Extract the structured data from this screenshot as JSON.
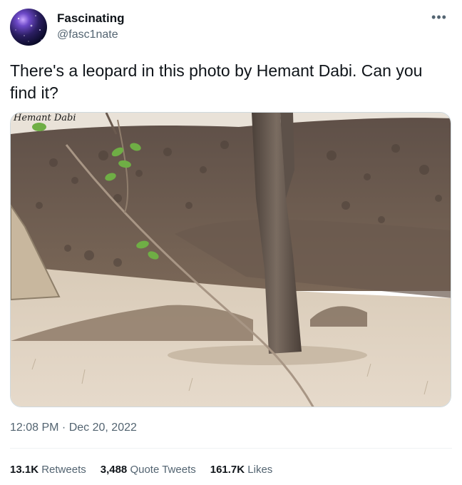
{
  "author": {
    "display_name": "Fascinating",
    "handle": "@fasc1nate"
  },
  "tweet": {
    "text": "There's a leopard in this photo by Hemant Dabi. Can you find it?",
    "media_watermark": "Hemant Dabi",
    "timestamp": "12:08 PM · Dec 20, 2022"
  },
  "stats": {
    "retweets_count": "13.1K",
    "retweets_label": "Retweets",
    "quote_tweets_count": "3,488",
    "quote_tweets_label": "Quote Tweets",
    "likes_count": "161.7K",
    "likes_label": "Likes"
  },
  "icons": {
    "more": "more-options-icon"
  }
}
